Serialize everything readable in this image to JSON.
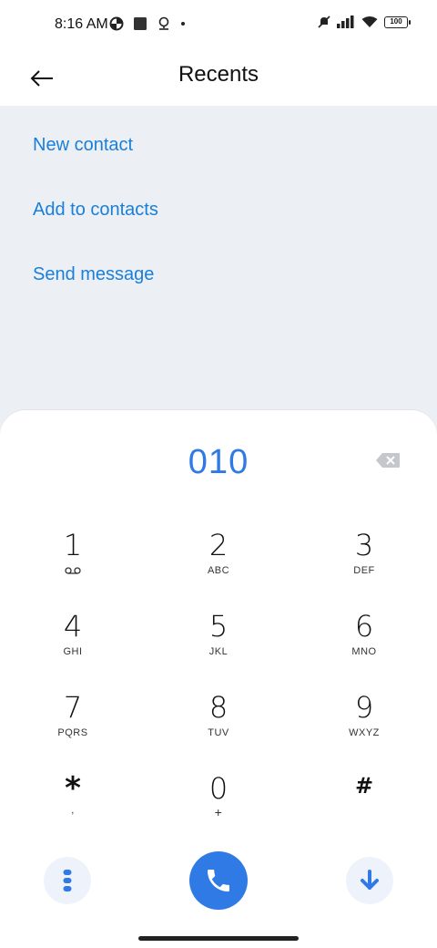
{
  "status_bar": {
    "time": "8:16 AM",
    "battery": "100",
    "left_icons": [
      "data-saver-icon",
      "square-notification-icon",
      "location-icon",
      "dot-icon"
    ],
    "right_icons": [
      "mute-icon",
      "signal-icon",
      "wifi-icon",
      "battery-icon"
    ]
  },
  "app_bar": {
    "title": "Recents",
    "back_icon": "back-arrow-icon"
  },
  "options": [
    {
      "label": "New contact"
    },
    {
      "label": "Add to contacts"
    },
    {
      "label": "Send message"
    }
  ],
  "dialer": {
    "number": "010",
    "backspace_icon": "backspace-icon",
    "keys": [
      {
        "digit": "1",
        "letters": "",
        "icon": "voicemail-icon"
      },
      {
        "digit": "2",
        "letters": "ABC"
      },
      {
        "digit": "3",
        "letters": "DEF"
      },
      {
        "digit": "4",
        "letters": "GHI"
      },
      {
        "digit": "5",
        "letters": "JKL"
      },
      {
        "digit": "6",
        "letters": "MNO"
      },
      {
        "digit": "7",
        "letters": "PQRS"
      },
      {
        "digit": "8",
        "letters": "TUV"
      },
      {
        "digit": "9",
        "letters": "WXYZ"
      },
      {
        "digit": "*",
        "letters": ","
      },
      {
        "digit": "0",
        "letters": "+"
      },
      {
        "digit": "#",
        "letters": ""
      }
    ]
  },
  "bottom_actions": {
    "menu_icon": "more-options-icon",
    "call_icon": "phone-icon",
    "collapse_icon": "arrow-down-icon"
  },
  "colors": {
    "accent": "#2f7ae5",
    "link": "#1a7fd9",
    "panel_bg": "#eceff4"
  }
}
